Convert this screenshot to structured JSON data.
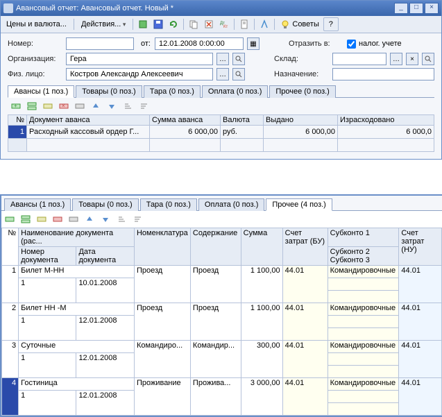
{
  "window": {
    "title": "Авансовый отчет: Авансовый отчет. Новый *",
    "min": "_",
    "max": "□",
    "close": "×"
  },
  "menu": {
    "prices": "Цены и валюта...",
    "actions": "Действия...",
    "advice": "Советы",
    "help": "?"
  },
  "form": {
    "number_lbl": "Номер:",
    "number_val": "",
    "from_lbl": "от:",
    "date_val": "12.01.2008 0:00:00",
    "reflect_lbl": "Отразить в:",
    "tax_chk": "налог. учете",
    "org_lbl": "Организация:",
    "org_val": "Гера",
    "sklad_lbl": "Склад:",
    "sklad_val": "",
    "person_lbl": "Физ. лицо:",
    "person_val": "Костров Александр Алексеевич",
    "dest_lbl": "Назначение:",
    "dest_val": ""
  },
  "tabs1": {
    "t1": "Авансы (1 поз.)",
    "t2": "Товары (0 поз.)",
    "t3": "Тара (0 поз.)",
    "t4": "Оплата (0 поз.)",
    "t5": "Прочее (0 поз.)"
  },
  "grid1": {
    "h_num": "№",
    "h_doc": "Документ аванса",
    "h_sum": "Сумма аванса",
    "h_cur": "Валюта",
    "h_iss": "Выдано",
    "h_spent": "Израсходовано",
    "r1_num": "1",
    "r1_doc": "Расходный кассовый ордер Г...",
    "r1_sum": "6 000,00",
    "r1_cur": "руб.",
    "r1_iss": "6 000,00",
    "r1_spent": "6 000,0"
  },
  "tabs2": {
    "t1": "Авансы (1 поз.)",
    "t2": "Товары (0 поз.)",
    "t3": "Тара (0 поз.)",
    "t4": "Оплата (0 поз.)",
    "t5": "Прочее (4 поз.)"
  },
  "grid2": {
    "h_num": "№",
    "h_name": "Наименование документа (рас...",
    "h_docnum": "Номер документа",
    "h_docdate": "Дата документа",
    "h_nomen": "Номенклатура",
    "h_content": "Содержание",
    "h_sum": "Сумма",
    "h_cost_bu": "Счет затрат (БУ)",
    "h_sub1": "Субконто 1",
    "h_sub2": "Субконто 2",
    "h_sub3": "Субконто 3",
    "h_cost_nu": "Счет затрат (НУ)",
    "rows": [
      {
        "n": "1",
        "name": "Билет М-НН",
        "dn": "1",
        "dd": "10.01.2008",
        "nom": "Проезд",
        "cont": "Проезд",
        "sum": "1 100,00",
        "bu": "44.01",
        "sub": "Командировочные",
        "nu": "44.01"
      },
      {
        "n": "2",
        "name": "Билет НН -М",
        "dn": "1",
        "dd": "12.01.2008",
        "nom": "Проезд",
        "cont": "Проезд",
        "sum": "1 100,00",
        "bu": "44.01",
        "sub": "Командировочные",
        "nu": "44.01"
      },
      {
        "n": "3",
        "name": "Суточные",
        "dn": "1",
        "dd": "12.01.2008",
        "nom": "Командиро...",
        "cont": "Командир...",
        "sum": "300,00",
        "bu": "44.01",
        "sub": "Командировочные",
        "nu": "44.01"
      },
      {
        "n": "4",
        "name": "Гостиница",
        "dn": "1",
        "dd": "12.01.2008",
        "nom": "Проживание",
        "cont": "Прожива...",
        "sum": "3 000,00",
        "bu": "44.01",
        "sub": "Командировочные",
        "nu": "44.01"
      }
    ]
  }
}
